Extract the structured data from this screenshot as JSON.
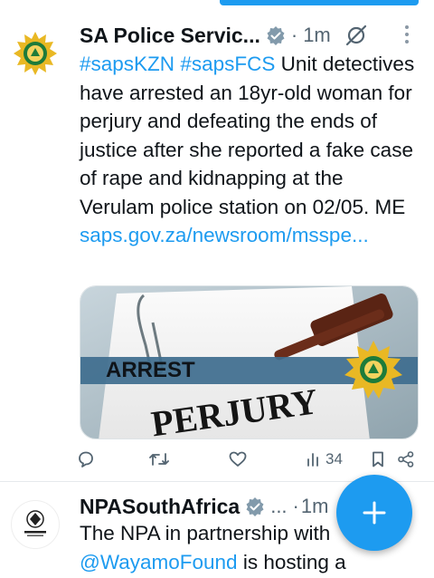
{
  "tweets": [
    {
      "author": "SA Police Servic...",
      "time": "1m",
      "separator": "·",
      "hashtags": [
        "#sapsKZN",
        "#sapsFCS"
      ],
      "text": "Unit detectives have arrested an 18yr-old woman for perjury and defeating the ends of justice after she reported a fake case of rape and kidnapping at the Verulam police station on 02/05. ME",
      "link": "saps.gov.za/newsroom/msspe...",
      "media": {
        "banner_text": "ARREST",
        "paper_text": "PERJURY"
      },
      "actions": {
        "views": "34"
      }
    },
    {
      "author": "NPASouthAfrica",
      "ellipsis": "...",
      "separator": "·",
      "time": "1m",
      "text_start": "The NPA in partnership with",
      "mention": "@WayamoFound",
      "text_end": " is hosting a"
    }
  ],
  "colors": {
    "accent": "#1d9bf0",
    "text": "#0f1419",
    "muted": "#536471"
  },
  "icons": [
    "verified-badge",
    "grok-icon",
    "more-vertical-icon",
    "reply-icon",
    "retweet-icon",
    "like-icon",
    "views-icon",
    "bookmark-icon",
    "share-icon",
    "compose-plus-icon"
  ]
}
